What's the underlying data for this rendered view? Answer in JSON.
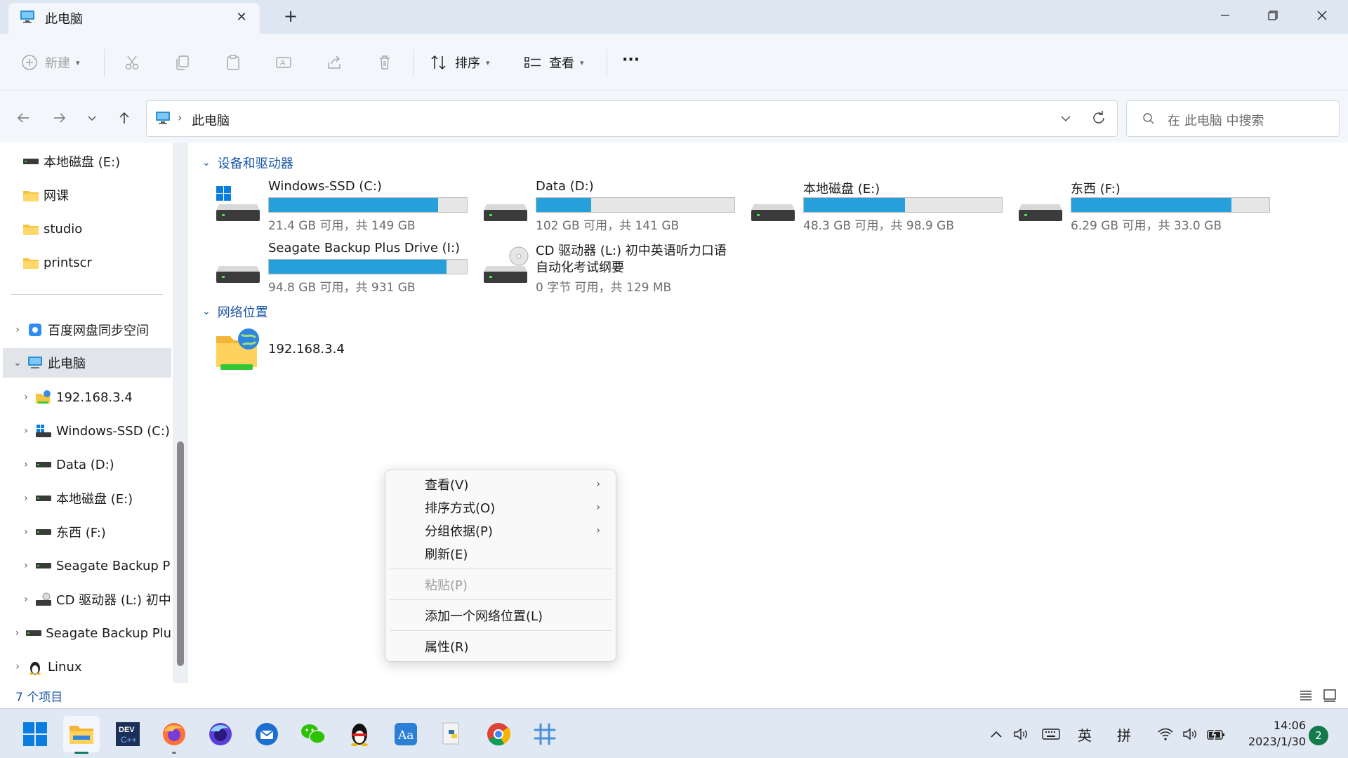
{
  "window": {
    "tab_title": "此电脑"
  },
  "commandbar": {
    "new_label": "新建",
    "sort_label": "排序",
    "view_label": "查看",
    "more": "···"
  },
  "address": {
    "crumb": "此电脑",
    "separator": "›",
    "search_placeholder": "在 此电脑 中搜索"
  },
  "nav": {
    "items": [
      {
        "label": "本地磁盘 (E:)",
        "icon": "drive-icon"
      },
      {
        "label": "网课",
        "icon": "folder-icon"
      },
      {
        "label": "studio",
        "icon": "folder-icon"
      },
      {
        "label": "printscr",
        "icon": "folder-icon"
      },
      {
        "label": "百度网盘同步空间",
        "icon": "baidu-netdisk-icon"
      },
      {
        "label": "此电脑",
        "icon": "computer-icon"
      },
      {
        "label": "192.168.3.4",
        "icon": "network-folder-icon"
      },
      {
        "label": "Windows-SSD (C:)",
        "icon": "windows-drive-icon"
      },
      {
        "label": "Data (D:)",
        "icon": "drive-icon"
      },
      {
        "label": "本地磁盘 (E:)",
        "icon": "drive-icon"
      },
      {
        "label": "东西 (F:)",
        "icon": "drive-icon"
      },
      {
        "label": "Seagate Backup P",
        "icon": "drive-icon"
      },
      {
        "label": "CD 驱动器 (L:) 初中",
        "icon": "cd-drive-icon"
      },
      {
        "label": "Seagate Backup Plu",
        "icon": "drive-icon"
      },
      {
        "label": "Linux",
        "icon": "linux-penguin-icon"
      }
    ]
  },
  "content": {
    "group_devices": "设备和驱动器",
    "group_network": "网络位置",
    "drives": [
      {
        "name": "Windows-SSD (C:)",
        "free": "21.4 GB 可用，共 149 GB",
        "used_fraction": 0.856
      },
      {
        "name": "Data (D:)",
        "free": "102 GB 可用，共 141 GB",
        "used_fraction": 0.277
      },
      {
        "name": "本地磁盘 (E:)",
        "free": "48.3 GB 可用，共 98.9 GB",
        "used_fraction": 0.512
      },
      {
        "name": "东西 (F:)",
        "free": "6.29 GB 可用，共 33.0 GB",
        "used_fraction": 0.809
      },
      {
        "name": "Seagate Backup Plus Drive (I:)",
        "free": "94.8 GB 可用，共 931 GB",
        "used_fraction": 0.898
      },
      {
        "name_line1": "CD 驱动器 (L:) 初中英语听力口语",
        "name_line2": "自动化考试纲要",
        "free": "0 字节 可用，共 129 MB"
      }
    ],
    "network": [
      {
        "name": "192.168.3.4"
      }
    ]
  },
  "status": {
    "count": "7 个项目"
  },
  "context_menu": {
    "items": [
      {
        "label": "查看(V)",
        "submenu": true,
        "enabled": true
      },
      {
        "label": "排序方式(O)",
        "submenu": true,
        "enabled": true
      },
      {
        "label": "分组依据(P)",
        "submenu": true,
        "enabled": true
      },
      {
        "label": "刷新(E)",
        "submenu": false,
        "enabled": true
      },
      {
        "label": "粘贴(P)",
        "submenu": false,
        "enabled": false
      },
      {
        "label": "添加一个网络位置(L)",
        "submenu": false,
        "enabled": true
      },
      {
        "label": "属性(R)",
        "submenu": false,
        "enabled": true
      }
    ]
  },
  "taskbar": {
    "apps": [
      "start-icon",
      "file-explorer-icon",
      "dev-cpp-icon",
      "firefox-icon",
      "firefox-nightly-icon",
      "thunderbird-icon",
      "wechat-icon",
      "qq-icon",
      "dictionary-icon",
      "python-icon",
      "chrome-icon",
      "slack-icon"
    ],
    "ime_lang": "英",
    "ime_mode": "拼",
    "time": "14:06",
    "date": "2023/1/30",
    "notifications": "2"
  },
  "colors": {
    "accent": "#26a0da",
    "link": "#1a57a8",
    "titlebar": "#dde6f1",
    "chrome": "#f3f6fb"
  }
}
